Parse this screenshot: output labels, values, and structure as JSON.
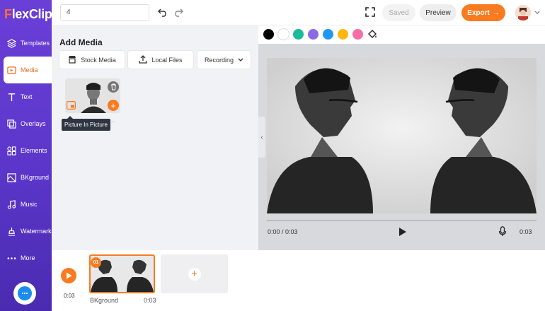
{
  "app": {
    "logo_text_1": "F",
    "logo_text_2": "lexClip"
  },
  "sidebar": {
    "items": [
      {
        "label": "Templates",
        "icon": "layers-icon"
      },
      {
        "label": "Media",
        "icon": "media-folder-icon",
        "active": true
      },
      {
        "label": "Text",
        "icon": "text-icon"
      },
      {
        "label": "Overlays",
        "icon": "overlays-icon"
      },
      {
        "label": "Elements",
        "icon": "elements-icon"
      },
      {
        "label": "BKground",
        "icon": "background-icon"
      },
      {
        "label": "Music",
        "icon": "music-note-icon"
      },
      {
        "label": "Watermark",
        "icon": "watermark-icon"
      },
      {
        "label": "More",
        "icon": "more-dots-icon"
      }
    ],
    "chat_icon": "chat-bubble-icon"
  },
  "topbar": {
    "project_name": "4",
    "saved_label": "Saved",
    "preview_label": "Preview",
    "export_label": "Export",
    "export_arrow": "→"
  },
  "media_panel": {
    "title": "Add Media",
    "buttons": {
      "stock": "Stock Media",
      "local": "Local Files",
      "recording": "Recording"
    },
    "tooltip": "Picture In Picture",
    "tooltip_trail": "...",
    "add_symbol": "+",
    "collapse_symbol": "‹"
  },
  "color_palette": {
    "colors": [
      "#000000",
      "#ffffff",
      "#1ab99a",
      "#8a6be4",
      "#1f98f2",
      "#fdb70f",
      "#f76ea7"
    ]
  },
  "player": {
    "current_time": "0:00 / 0:03",
    "duration": "0:03"
  },
  "timeline": {
    "time": "0:03",
    "clip": {
      "number": "01",
      "label": "BKground",
      "duration": "0:03"
    },
    "add_symbol": "+"
  },
  "theme": {
    "accent": "#f97a1f",
    "sidebar": "#5b36c9"
  }
}
